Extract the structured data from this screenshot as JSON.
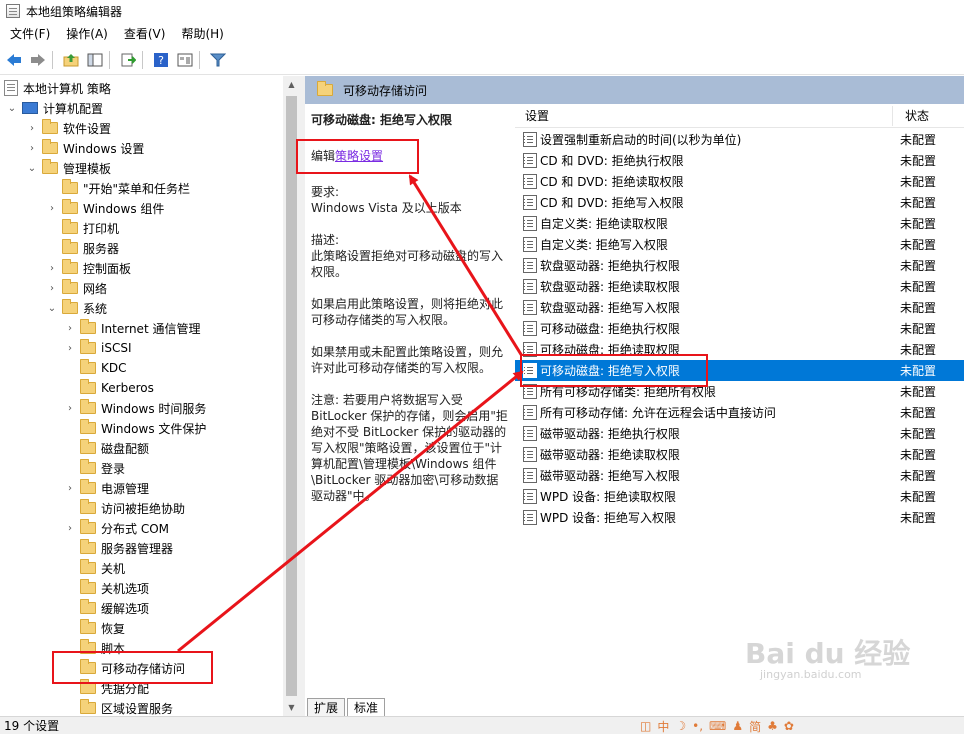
{
  "window": {
    "title": "本地组策略编辑器"
  },
  "menubar": [
    "文件(F)",
    "操作(A)",
    "查看(V)",
    "帮助(H)"
  ],
  "toolbar": [
    "back-icon",
    "forward-icon",
    "up-folder-icon",
    "show-hide-tree-icon",
    "export-list-icon",
    "help-icon",
    "properties-icon",
    "filter-icon"
  ],
  "tree": {
    "root": "本地计算机 策略",
    "computer_config": "计算机配置",
    "items": [
      {
        "label": "软件设置",
        "level": 2,
        "expander": "›"
      },
      {
        "label": "Windows 设置",
        "level": 2,
        "expander": "›"
      },
      {
        "label": "管理模板",
        "level": 2,
        "expander": "⌄"
      },
      {
        "label": "\"开始\"菜单和任务栏",
        "level": 3,
        "expander": ""
      },
      {
        "label": "Windows 组件",
        "level": 3,
        "expander": "›"
      },
      {
        "label": "打印机",
        "level": 3,
        "expander": ""
      },
      {
        "label": "服务器",
        "level": 3,
        "expander": ""
      },
      {
        "label": "控制面板",
        "level": 3,
        "expander": "›"
      },
      {
        "label": "网络",
        "level": 3,
        "expander": "›"
      },
      {
        "label": "系统",
        "level": 3,
        "expander": "⌄"
      },
      {
        "label": "Internet 通信管理",
        "level": 4,
        "expander": "›"
      },
      {
        "label": "iSCSI",
        "level": 4,
        "expander": "›"
      },
      {
        "label": "KDC",
        "level": 4,
        "expander": ""
      },
      {
        "label": "Kerberos",
        "level": 4,
        "expander": ""
      },
      {
        "label": "Windows 时间服务",
        "level": 4,
        "expander": "›"
      },
      {
        "label": "Windows 文件保护",
        "level": 4,
        "expander": ""
      },
      {
        "label": "磁盘配额",
        "level": 4,
        "expander": ""
      },
      {
        "label": "登录",
        "level": 4,
        "expander": ""
      },
      {
        "label": "电源管理",
        "level": 4,
        "expander": "›"
      },
      {
        "label": "访问被拒绝协助",
        "level": 4,
        "expander": ""
      },
      {
        "label": "分布式 COM",
        "level": 4,
        "expander": "›"
      },
      {
        "label": "服务器管理器",
        "level": 4,
        "expander": ""
      },
      {
        "label": "关机",
        "level": 4,
        "expander": ""
      },
      {
        "label": "关机选项",
        "level": 4,
        "expander": ""
      },
      {
        "label": "缓解选项",
        "level": 4,
        "expander": ""
      },
      {
        "label": "恢复",
        "level": 4,
        "expander": ""
      },
      {
        "label": "脚本",
        "level": 4,
        "expander": ""
      },
      {
        "label": "可移动存储访问",
        "level": 4,
        "expander": "",
        "selected": true
      },
      {
        "label": "凭据分配",
        "level": 4,
        "expander": ""
      },
      {
        "label": "区域设置服务",
        "level": 4,
        "expander": ""
      }
    ]
  },
  "right_header": "可移动存储访问",
  "description": {
    "policy_name": "可移动磁盘: 拒绝写入权限",
    "edit_prefix": "编辑",
    "edit_link": "策略设置",
    "requirements_label": "要求:",
    "requirements": "Windows Vista 及以上版本",
    "desc_label": "描述:",
    "desc": "此策略设置拒绝对可移动磁盘的写入权限。",
    "enabled": "如果启用此策略设置，则将拒绝对此可移动存储类的写入权限。",
    "disabled": "如果禁用或未配置此策略设置，则允许对此可移动存储类的写入权限。",
    "note": "注意: 若要用户将数据写入受 BitLocker 保护的存储，则会启用\"拒绝对不受 BitLocker 保护的驱动器的写入权限\"策略设置，该设置位于\"计算机配置\\管理模板\\Windows 组件\\BitLocker 驱动器加密\\可移动数据驱动器\"中。"
  },
  "list": {
    "col_setting": "设置",
    "col_state": "状态",
    "rows": [
      {
        "name": "设置强制重新启动的时间(以秒为单位)",
        "state": "未配置"
      },
      {
        "name": "CD 和 DVD: 拒绝执行权限",
        "state": "未配置"
      },
      {
        "name": "CD 和 DVD: 拒绝读取权限",
        "state": "未配置"
      },
      {
        "name": "CD 和 DVD: 拒绝写入权限",
        "state": "未配置"
      },
      {
        "name": "自定义类: 拒绝读取权限",
        "state": "未配置"
      },
      {
        "name": "自定义类: 拒绝写入权限",
        "state": "未配置"
      },
      {
        "name": "软盘驱动器: 拒绝执行权限",
        "state": "未配置"
      },
      {
        "name": "软盘驱动器: 拒绝读取权限",
        "state": "未配置"
      },
      {
        "name": "软盘驱动器: 拒绝写入权限",
        "state": "未配置"
      },
      {
        "name": "可移动磁盘: 拒绝执行权限",
        "state": "未配置"
      },
      {
        "name": "可移动磁盘: 拒绝读取权限",
        "state": "未配置"
      },
      {
        "name": "可移动磁盘: 拒绝写入权限",
        "state": "未配置",
        "selected": true
      },
      {
        "name": "所有可移动存储类: 拒绝所有权限",
        "state": "未配置"
      },
      {
        "name": "所有可移动存储: 允许在远程会话中直接访问",
        "state": "未配置"
      },
      {
        "name": "磁带驱动器: 拒绝执行权限",
        "state": "未配置"
      },
      {
        "name": "磁带驱动器: 拒绝读取权限",
        "state": "未配置"
      },
      {
        "name": "磁带驱动器: 拒绝写入权限",
        "state": "未配置"
      },
      {
        "name": "WPD 设备: 拒绝读取权限",
        "state": "未配置"
      },
      {
        "name": "WPD 设备: 拒绝写入权限",
        "state": "未配置"
      }
    ]
  },
  "tabs": [
    "扩展",
    "标准"
  ],
  "status": "19 个设置",
  "status_tray": [
    "中",
    "简"
  ],
  "watermark": {
    "main": "Bai du 经验",
    "sub": "jingyan.baidu.com"
  },
  "colors": {
    "selection": "#0078d7",
    "header": "#a9bcd6",
    "annotation": "#e8141a",
    "link": "#7a2be2"
  }
}
